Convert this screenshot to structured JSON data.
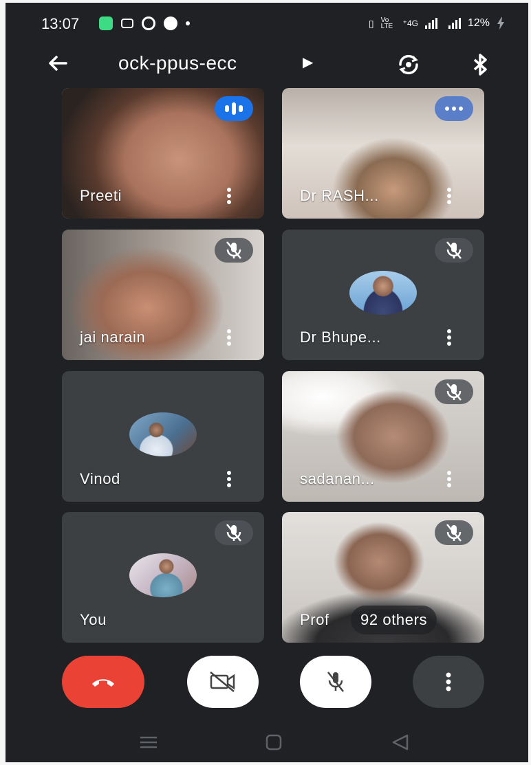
{
  "status_bar": {
    "time": "13:07",
    "volte": "Vo LTE",
    "network": "⁺4G",
    "battery": "12%",
    "icons": [
      "chat-icon",
      "video-icon",
      "grid-icon",
      "phone-icon",
      "dot-icon",
      "vibrate-icon",
      "volte-icon",
      "signal-icon",
      "signal-icon",
      "battery-charging-icon"
    ]
  },
  "header": {
    "title": "ock-ppus-ecc",
    "icons": [
      "back-arrow-icon",
      "chevron-right-icon",
      "switch-camera-icon",
      "bluetooth-icon"
    ]
  },
  "tiles": [
    {
      "name": "Preeti",
      "status": "speaking",
      "type": "video"
    },
    {
      "name": "Dr RASH...",
      "status": "speaking",
      "type": "video"
    },
    {
      "name": "jai narain",
      "status": "muted",
      "type": "video"
    },
    {
      "name": "Dr Bhupe...",
      "status": "muted",
      "type": "avatar"
    },
    {
      "name": "Vinod",
      "status": "none",
      "type": "avatar"
    },
    {
      "name": "sadanan...",
      "status": "muted",
      "type": "video"
    },
    {
      "name": "You",
      "status": "muted",
      "type": "avatar"
    },
    {
      "name": "Prof",
      "others": "92 others",
      "status": "muted",
      "type": "video"
    }
  ],
  "controls": [
    "end-call-icon",
    "camera-off-icon",
    "mic-off-icon",
    "more-vert-icon"
  ],
  "colors": {
    "background": "#202124",
    "tile": "#3c4043",
    "end_call": "#ea4335",
    "speaking": "#1a73e8",
    "chat_app": "#3ddc84"
  }
}
